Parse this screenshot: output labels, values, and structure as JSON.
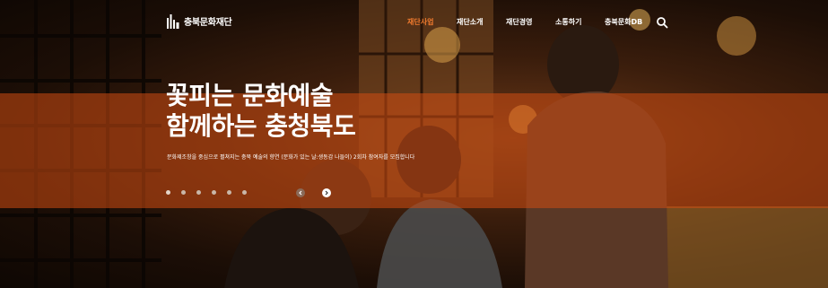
{
  "site": {
    "logo_text": "충북문화재단"
  },
  "nav": {
    "items": [
      {
        "label": "재단사업",
        "active": true
      },
      {
        "label": "재단소개",
        "active": false
      },
      {
        "label": "재단경영",
        "active": false
      },
      {
        "label": "소통하기",
        "active": false
      },
      {
        "label": "충북문화DB",
        "active": false
      }
    ],
    "search_icon": "search-icon"
  },
  "hero": {
    "headline_line1": "꽃피는 문화예술",
    "headline_line2": "함께하는 충청북도",
    "subtext": "문화제조창을 중심으로 펼쳐지는 충북 예술의 향연 (문화가 있는 날:생동감 나들이) 2회차 참여자를 모집합니다",
    "slides_total": 6,
    "active_slide": 1
  },
  "colors": {
    "accent": "#f07a2e",
    "band": "#d04c12"
  }
}
